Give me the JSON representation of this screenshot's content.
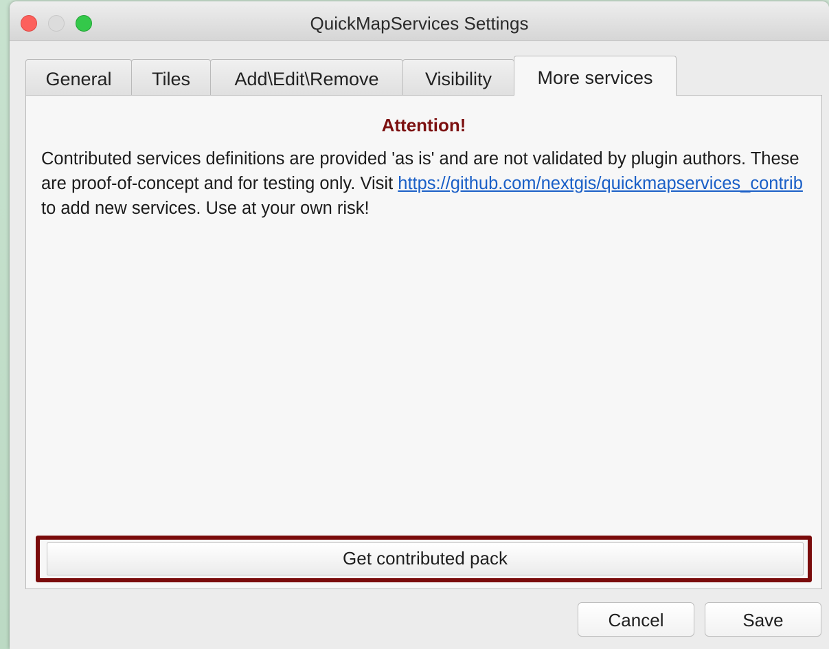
{
  "window": {
    "title": "QuickMapServices Settings"
  },
  "tabs": [
    {
      "label": "General",
      "active": false
    },
    {
      "label": "Tiles",
      "active": false
    },
    {
      "label": "Add\\Edit\\Remove",
      "active": false
    },
    {
      "label": "Visibility",
      "active": false
    },
    {
      "label": "More services",
      "active": true
    }
  ],
  "more_services": {
    "heading": "Attention!",
    "message_before": "Contributed services definitions are provided 'as is' and are not validated by plugin authors. These are proof-of-concept and for testing only. Visit ",
    "link_text": "https://github.com/nextgis/quickmapservices_contrib",
    "message_after": " to add new services. Use at your own risk!",
    "button_label": "Get contributed pack"
  },
  "footer": {
    "cancel_label": "Cancel",
    "save_label": "Save"
  },
  "colors": {
    "attention": "#7c1010",
    "link": "#1a5fc7",
    "highlight_border": "#7a0b0b"
  }
}
